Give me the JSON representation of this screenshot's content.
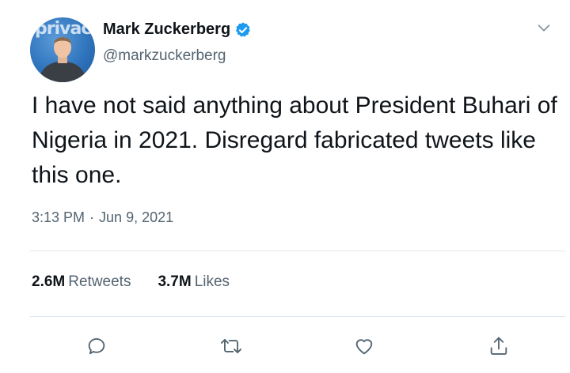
{
  "author": {
    "display_name": "Mark Zuckerberg",
    "handle": "@markzuckerberg",
    "avatar_text": "privac",
    "verified": true
  },
  "tweet": {
    "text": "I have not said anything about President Buhari of Nigeria in 2021. Disregard fabricated tweets like this one.",
    "time": "3:13 PM",
    "separator": "·",
    "date": "Jun 9, 2021"
  },
  "stats": {
    "retweets_count": "2.6M",
    "retweets_label": "Retweets",
    "likes_count": "3.7M",
    "likes_label": "Likes"
  },
  "actions": {
    "icons": [
      "reply-icon",
      "retweet-icon",
      "like-icon",
      "share-icon"
    ]
  },
  "colors": {
    "verified_blue": "#1d9bf0",
    "icon_gray": "#536471",
    "divider": "#e1e8ed"
  }
}
